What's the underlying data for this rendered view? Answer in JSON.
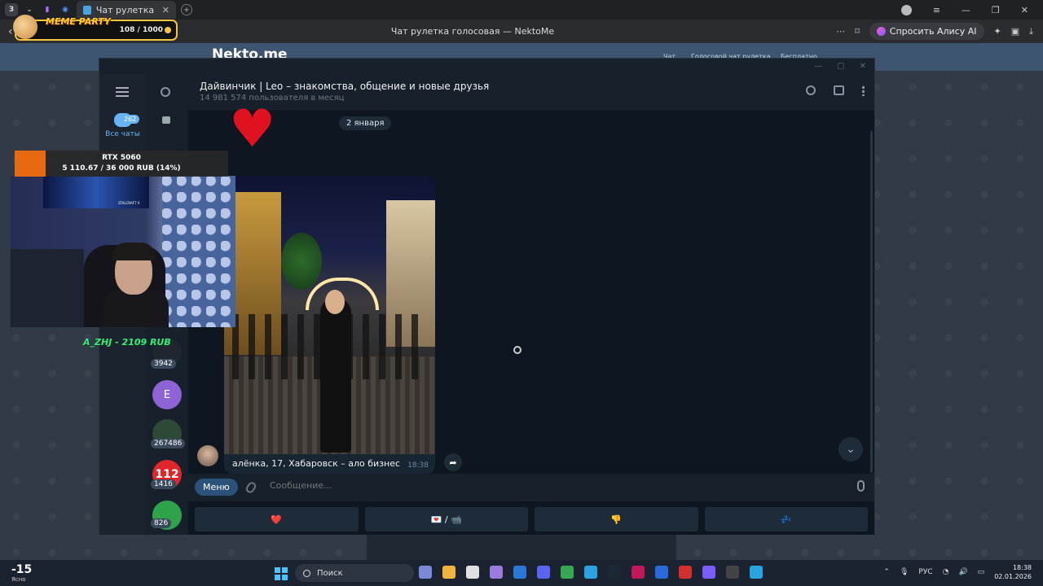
{
  "browser": {
    "tab_badge": "3",
    "active_tab_title": "Чат рулетка голосовая",
    "page_title": "Чат рулетка голосовая — NektoMe",
    "alice_label": "Спросить Алису AI"
  },
  "meme_party": {
    "title": "MEME PARTY",
    "progress": "108 / 1000"
  },
  "site": {
    "logo": "Nekto.me",
    "nav": [
      "Чат",
      "Голосовой чат рулетка",
      "Бесплатно"
    ]
  },
  "telegram": {
    "sidebar": {
      "all_chats_label": "Все чаты",
      "all_chats_count": "262"
    },
    "chat_list": [
      {
        "initial": "",
        "count": "3942",
        "color": "#1f2630"
      },
      {
        "initial": "E",
        "count": "",
        "color": "#8d63d6"
      },
      {
        "initial": "",
        "count": "267486",
        "color": "#2d4a36"
      },
      {
        "initial": "112",
        "count": "1416",
        "color": "#e0262a"
      },
      {
        "initial": "",
        "count": "826",
        "color": "#2fa34a"
      }
    ],
    "header": {
      "name": "Дайвинчик | Leo – знакомства, общение и новые друзья",
      "subtitle": "14 981 574 пользователя в месяц"
    },
    "date_pill": "2 января",
    "message": {
      "caption": "алёнка, 17, Хабаровск – ало бизнес",
      "time": "18:38"
    },
    "composer": {
      "menu_label": "Меню",
      "placeholder": "Сообщение..."
    },
    "keyboard": [
      {
        "label": "❤️",
        "color": "#e0121f"
      },
      {
        "label": "💌 / 📹",
        "color": "#eeeeee"
      },
      {
        "label": "👎",
        "color": "#f5c542"
      },
      {
        "label": "💤",
        "color": "#4a7bd8"
      }
    ]
  },
  "stream": {
    "goal_title": "RTX 5060",
    "goal_value": "5 110.67 / 36 000 RUB (14%)",
    "goal_progress": 0.14,
    "donor": "A_ZHJ - 2109 RUB",
    "poster_text": "STALCRAFT X"
  },
  "taskbar": {
    "weather_temp": "-15",
    "weather_label": "Ясно",
    "search_placeholder": "Поиск",
    "lang": "РУС",
    "time": "18:38",
    "date": "02.01.2026",
    "apps": [
      "#7a8ad8",
      "#f2b33d",
      "#e0e0e0",
      "#9a7be0",
      "#2b79d6",
      "#5865f2",
      "#34a853",
      "#2aa3e0",
      "#1b2838",
      "#c2185b",
      "#2a6ad8",
      "#d32f2f",
      "#7b5cff",
      "#444444",
      "#2aa3e0"
    ]
  }
}
